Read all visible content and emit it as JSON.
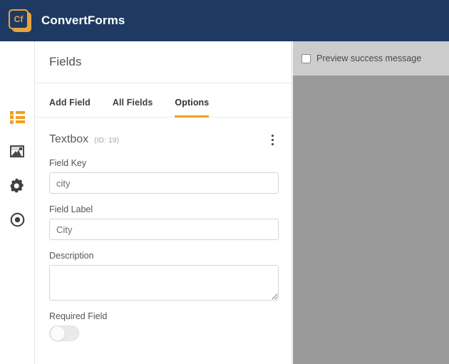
{
  "topbar": {
    "logo_text": "Cf",
    "logo_icon": "convertforms-logo-icon",
    "title": "ConvertForms"
  },
  "sidebar": {
    "items": [
      {
        "icon": "list-icon",
        "label": "Fields",
        "active": true
      },
      {
        "icon": "image-icon",
        "label": "Media",
        "active": false
      },
      {
        "icon": "gear-icon",
        "label": "Settings",
        "active": false
      },
      {
        "icon": "target-icon",
        "label": "Behaviour",
        "active": false
      }
    ]
  },
  "panel": {
    "title": "Fields",
    "tabs": [
      {
        "label": "Add Field",
        "active": false
      },
      {
        "label": "All Fields",
        "active": false
      },
      {
        "label": "Options",
        "active": true
      }
    ],
    "field": {
      "type_name": "Textbox",
      "id_text": "(ID: 19)",
      "menu_icon": "kebab-menu-icon",
      "inputs": [
        {
          "label": "Field Key",
          "value": "city",
          "placeholder": ""
        },
        {
          "label": "Field Label",
          "value": "City",
          "placeholder": ""
        }
      ],
      "description": {
        "label": "Description",
        "value": "",
        "placeholder": ""
      },
      "required": {
        "label": "Required Field",
        "state": "off"
      }
    }
  },
  "preview": {
    "checkbox_label": "Preview success message",
    "checkbox_checked": false
  },
  "colors": {
    "navy": "#1e3a63",
    "accent_orange": "#f0a01e",
    "logo_gold": "#e8a33d",
    "preview_toolbar": "#cccccc",
    "preview_stage": "#9a9a9a",
    "panel_border": "#e2e2e2",
    "input_border": "#d6d6d6"
  }
}
